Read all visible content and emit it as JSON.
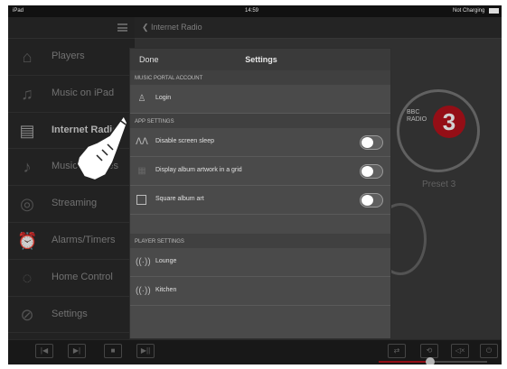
{
  "statusbar": {
    "device": "iPad",
    "time": "14:59",
    "charging": "Not Charging"
  },
  "sidebar": {
    "items": [
      {
        "label": "Players",
        "icon": "house-icon"
      },
      {
        "label": "Music on iPad",
        "icon": "music-note-icon"
      },
      {
        "label": "Internet Radio",
        "icon": "radio-icon"
      },
      {
        "label": "Music Libraries",
        "icon": "music-library-icon"
      },
      {
        "label": "Streaming",
        "icon": "globe-icon"
      },
      {
        "label": "Alarms/Timers",
        "icon": "alarm-clock-icon"
      },
      {
        "label": "Home Control",
        "icon": "light-bulb-icon"
      },
      {
        "label": "Settings",
        "icon": "settings-icon"
      }
    ]
  },
  "main": {
    "back_label": "Internet Radio",
    "preset": {
      "station_text_1": "BBC",
      "station_text_2": "RADIO",
      "number": "3",
      "label": "Preset 3"
    }
  },
  "modal": {
    "done_label": "Done",
    "title": "Settings",
    "sections": {
      "account": "MUSIC PORTAL ACCOUNT",
      "app": "APP SETTINGS",
      "players": "PLAYER SETTINGS"
    },
    "login_label": "Login",
    "app_settings": [
      {
        "label": "Disable screen sleep",
        "on": false
      },
      {
        "label": "Display album artwork in a grid",
        "on": false
      },
      {
        "label": "Square album art",
        "on": false
      }
    ],
    "players": [
      {
        "label": "Lounge"
      },
      {
        "label": "Kitchen"
      }
    ]
  },
  "colors": {
    "accent": "#b5121b",
    "background": "#2a2a2a",
    "modal": "#4a4a4a"
  }
}
